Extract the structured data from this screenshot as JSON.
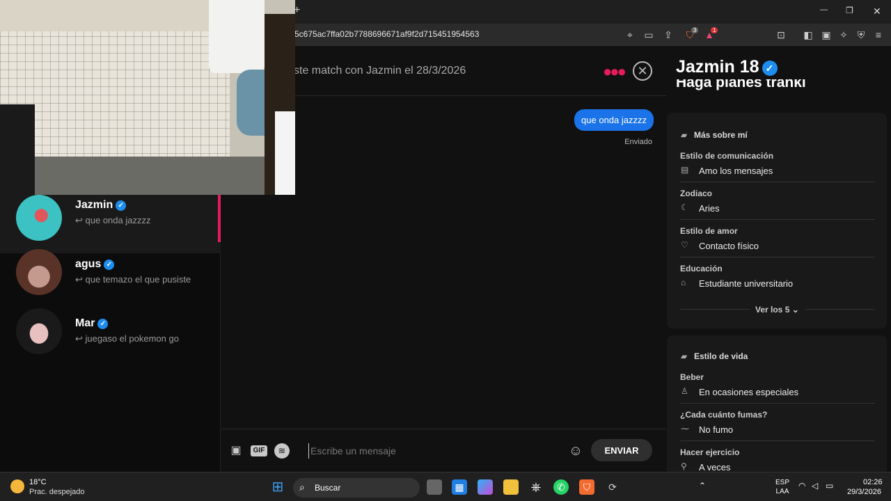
{
  "browser": {
    "url": "5c675ac7ffa02b7788696671af9f2d715451954563",
    "new_tab": "+",
    "min": "—",
    "max": "❐",
    "close": "✕",
    "shield_badge": "3",
    "alert_badge": "1"
  },
  "conversations": [
    {
      "name": "Jazmin",
      "preview": "que onda jazzzz",
      "active": true,
      "avatar_color": "#3cc2c2"
    },
    {
      "name": "agus",
      "preview": "que temazo el que pusiste",
      "active": false,
      "avatar_color": "#7a4a3a"
    },
    {
      "name": "Mar",
      "preview": "juegaso el pokemon go",
      "active": false,
      "avatar_color": "#5a3a3a"
    }
  ],
  "chat": {
    "match_text": "ste match con Jazmin el 28/3/2026",
    "message": "que onda jazzzz",
    "status": "Enviado",
    "input_placeholder": "Escribe un mensaje",
    "send_label": "ENVIAR",
    "gif_label": "GIF"
  },
  "profile": {
    "name": "Jazmin",
    "age": "18",
    "bio_partial": "Haga planes tranki",
    "more_about": {
      "title": "Más sobre mí",
      "fields": [
        {
          "label": "Estilo de comunicación",
          "value": "Amo los mensajes",
          "icon": "chat-icon"
        },
        {
          "label": "Zodiaco",
          "value": "Aries",
          "icon": "moon-icon"
        },
        {
          "label": "Estilo de amor",
          "value": "Contacto físico",
          "icon": "heart-message-icon"
        },
        {
          "label": "Educación",
          "value": "Estudiante universitario",
          "icon": "graduation-icon"
        }
      ],
      "see_all": "Ver los 5"
    },
    "lifestyle": {
      "title": "Estilo de vida",
      "fields": [
        {
          "label": "Beber",
          "value": "En ocasiones especiales",
          "icon": "glass-icon"
        },
        {
          "label": "¿Cada cuánto fumas?",
          "value": "No fumo",
          "icon": "smoke-icon"
        },
        {
          "label": "Hacer ejercicio",
          "value": "A veces",
          "icon": "dumbbell-icon"
        }
      ]
    }
  },
  "taskbar": {
    "weather_temp": "18°C",
    "weather_desc": "Prac. despejado",
    "search_label": "Buscar",
    "lang": "ESP",
    "lang2": "LAA",
    "time": "02:26",
    "date": "29/3/2026"
  },
  "colors": {
    "accent": "#e61b5c",
    "bubble": "#1a73e8",
    "verified": "#1d8df0"
  }
}
